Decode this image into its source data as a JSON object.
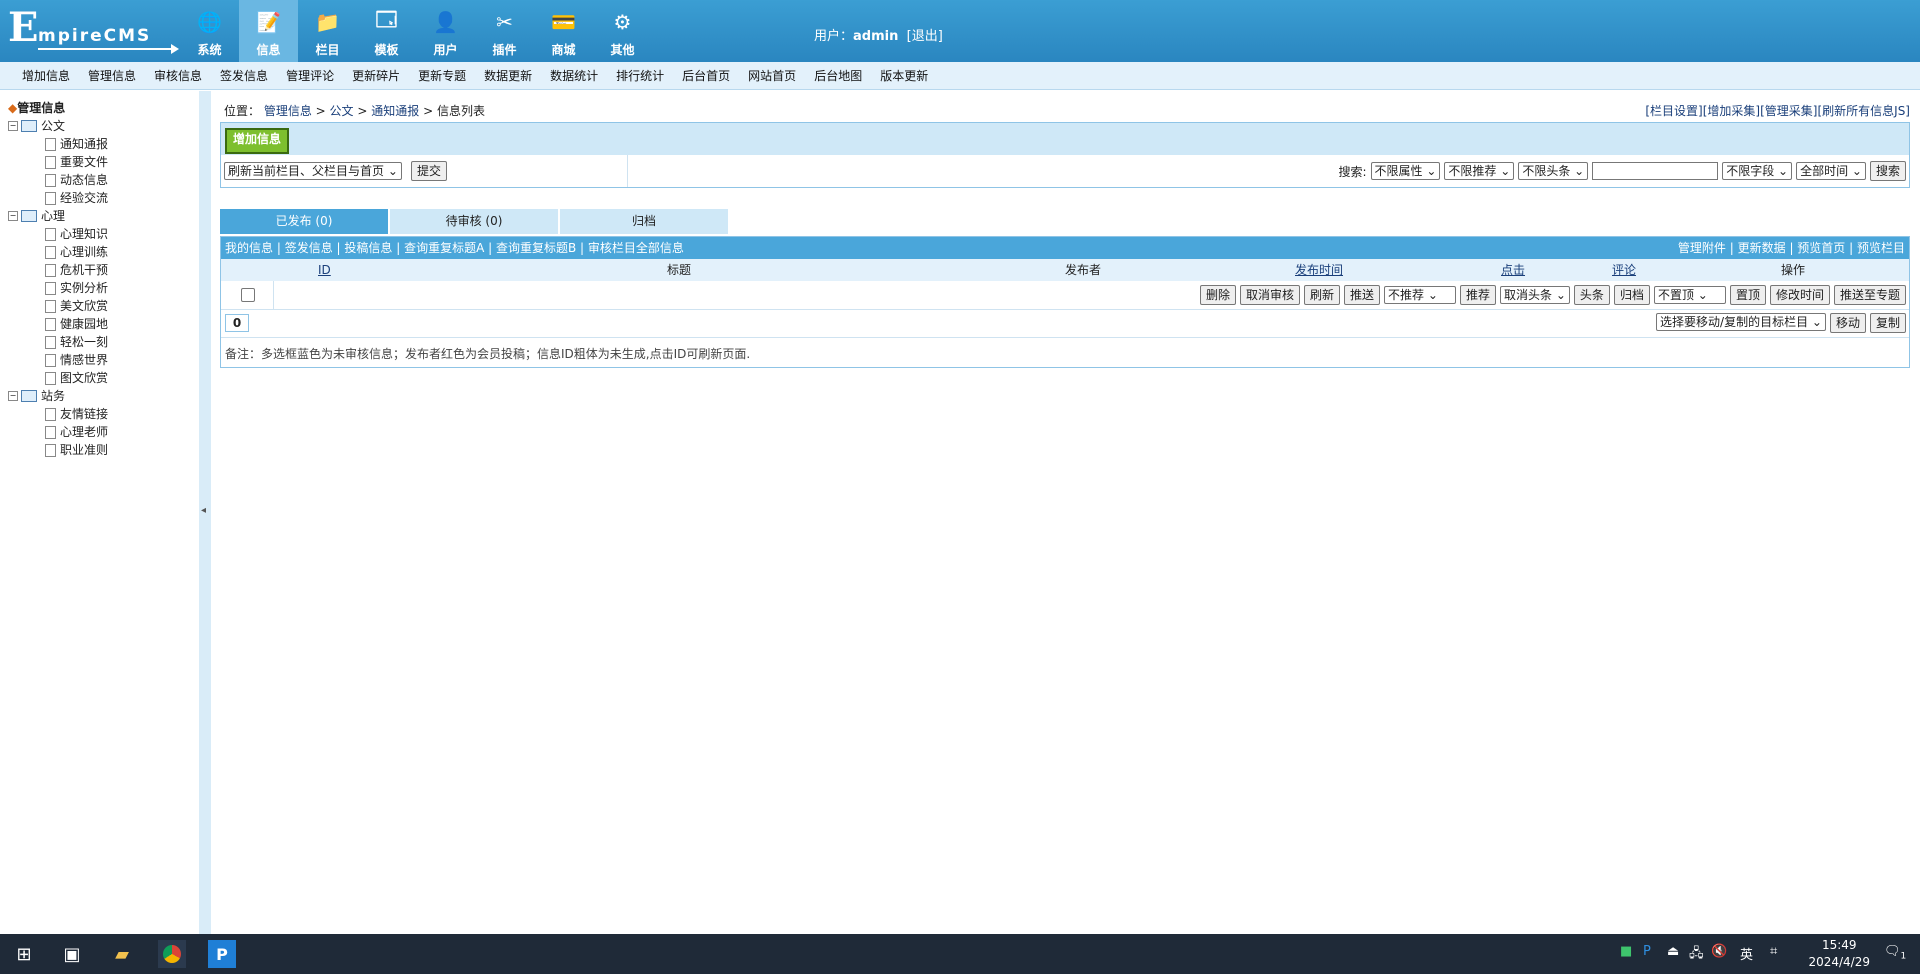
{
  "brand": {
    "logo_letter": "E",
    "logo_rest": "mpireCMS"
  },
  "topnav": [
    {
      "label": "系统",
      "icon": "globe-icon",
      "glyph": "🌐"
    },
    {
      "label": "信息",
      "icon": "edit-icon",
      "glyph": "📝"
    },
    {
      "label": "栏目",
      "icon": "folder-icon",
      "glyph": "📁"
    },
    {
      "label": "模板",
      "icon": "template-icon",
      "glyph": "🗔"
    },
    {
      "label": "用户",
      "icon": "user-icon",
      "glyph": "👤"
    },
    {
      "label": "插件",
      "icon": "tools-icon",
      "glyph": "✂"
    },
    {
      "label": "商城",
      "icon": "card-icon",
      "glyph": "💳"
    },
    {
      "label": "其他",
      "icon": "gear-icon",
      "glyph": "⚙"
    }
  ],
  "user": {
    "prefix": "用户：",
    "name": "admin",
    "logout": "[退出]"
  },
  "submenu": [
    "增加信息",
    "管理信息",
    "审核信息",
    "签发信息",
    "管理评论",
    "更新碎片",
    "更新专题",
    "数据更新",
    "数据统计",
    "排行统计",
    "后台首页",
    "网站首页",
    "后台地图",
    "版本更新"
  ],
  "sidebar": {
    "title": "管理信息",
    "tree": [
      {
        "name": "公文",
        "items": [
          "通知通报",
          "重要文件",
          "动态信息",
          "经验交流"
        ]
      },
      {
        "name": "心理",
        "items": [
          "心理知识",
          "心理训练",
          "危机干预",
          "实例分析",
          "美文欣赏",
          "健康园地",
          "轻松一刻",
          "情感世界",
          "图文欣赏"
        ]
      },
      {
        "name": "站务",
        "items": [
          "友情链接",
          "心理老师",
          "职业准则"
        ]
      }
    ],
    "collapse_glyph": "◂"
  },
  "breadcrumb": {
    "prefix": "位置：",
    "parts": [
      "管理信息",
      "公文",
      "通知通报"
    ],
    "current": "信息列表",
    "sep": " > "
  },
  "toplinks": [
    "[栏目设置]",
    "[增加采集]",
    "[管理采集]",
    "[刷新所有信息JS]"
  ],
  "panel": {
    "add_button": "增加信息",
    "refresh_select": "刷新当前栏目、父栏目与首页",
    "submit": "提交",
    "search_label": "搜索:",
    "search_filters": [
      "不限属性",
      "不限推荐",
      "不限头条"
    ],
    "field_select": "不限字段",
    "time_select": "全部时间",
    "search_button": "搜索"
  },
  "tabs": [
    "已发布 (0)",
    "待审核 (0)",
    "归档"
  ],
  "list_links": {
    "left": [
      "我的信息",
      "签发信息",
      "投稿信息",
      "查询重复标题A",
      "查询重复标题B",
      "审核栏目全部信息"
    ],
    "right": [
      "管理附件",
      "更新数据",
      "预览首页",
      "预览栏目"
    ]
  },
  "columns": {
    "id": "ID",
    "title": "标题",
    "publisher": "发布者",
    "time": "发布时间",
    "hits": "点击",
    "comments": "评论",
    "ops": "操作"
  },
  "actions": {
    "delete": "删除",
    "unapprove": "取消审核",
    "refresh": "刷新",
    "push": "推送",
    "recommend_select": "不推荐",
    "recommend": "推荐",
    "headline_select": "取消头条",
    "headline": "头条",
    "archive": "归档",
    "top_select": "不置顶",
    "top": "置顶",
    "modify_time": "修改时间",
    "push_topic": "推送至专题"
  },
  "count": "0",
  "move": {
    "select": "选择要移动/复制的目标栏目",
    "move": "移动",
    "copy": "复制"
  },
  "note": "备注：多选框蓝色为未审核信息；发布者红色为会员投稿；信息ID粗体为未生成,点击ID可刷新页面.",
  "taskbar": {
    "time": "15:49",
    "date": "2024/4/29",
    "ime": "英",
    "notify_count": "1"
  }
}
